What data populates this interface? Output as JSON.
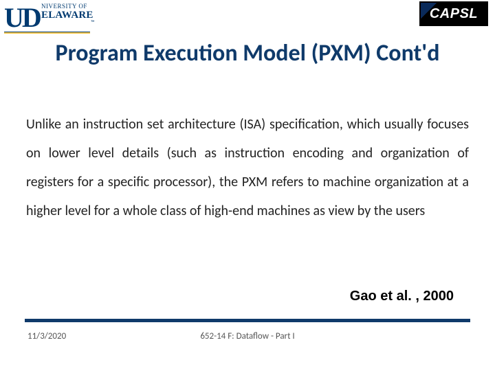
{
  "logos": {
    "left": {
      "monogram": "UD",
      "line1": "NIVERSITY OF",
      "line2": "ELAWARE",
      "tm": "™"
    },
    "right": {
      "label": "CAPSL"
    }
  },
  "title": "Program Execution Model (PXM) Cont'd",
  "body": "Unlike an instruction set architecture (ISA) specification, which usually focuses on lower level details (such as instruction encoding and organization of registers for a specific processor), the PXM refers to machine organization at a higher level for a whole class of high-end machines as view by the users",
  "citation": "Gao et al. , 2000",
  "footer": {
    "date": "11/3/2020",
    "center": "652-14 F: Dataflow - Part I"
  }
}
